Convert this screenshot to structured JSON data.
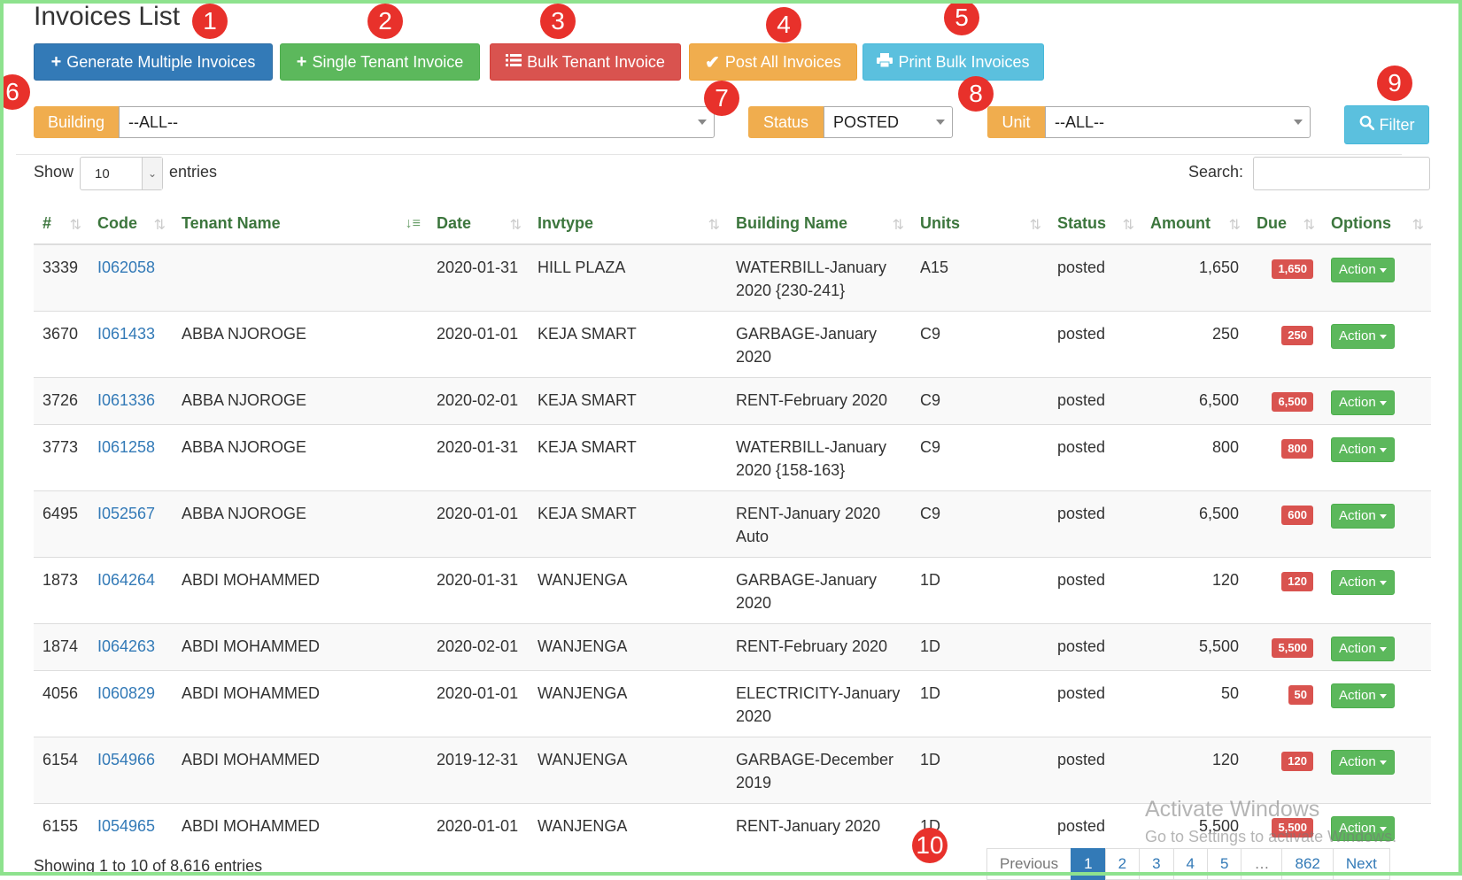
{
  "page": {
    "title": "Invoices List"
  },
  "toolbar": {
    "generate_multiple": "Generate Multiple Invoices",
    "single_tenant": "Single Tenant Invoice",
    "bulk_tenant": "Bulk Tenant Invoice",
    "post_all": "Post All Invoices",
    "print_bulk": "Print Bulk Invoices"
  },
  "filters": {
    "building_label": "Building",
    "building_value": "--ALL--",
    "status_label": "Status",
    "status_value": "POSTED",
    "unit_label": "Unit",
    "unit_value": "--ALL--",
    "filter_button": "Filter"
  },
  "table_controls": {
    "show_label": "Show",
    "entries_value": "10",
    "entries_label": "entries",
    "search_label": "Search:"
  },
  "table": {
    "headers": [
      "#",
      "Code",
      "Tenant Name",
      "Date",
      "Invtype",
      "Building Name",
      "Units",
      "Status",
      "Amount",
      "Due",
      "Options"
    ],
    "rows": [
      {
        "id": "3339",
        "code": "I062058",
        "tenant": "",
        "date": "2020-01-31",
        "invtype": "HILL PLAZA",
        "building": "WATERBILL-January 2020 {230-241}",
        "units": "A15",
        "status": "posted",
        "amount": "1,650",
        "due": "1,650",
        "action": "Action"
      },
      {
        "id": "3670",
        "code": "I061433",
        "tenant": "ABBA NJOROGE",
        "date": "2020-01-01",
        "invtype": "KEJA SMART",
        "building": "GARBAGE-January 2020",
        "units": "C9",
        "status": "posted",
        "amount": "250",
        "due": "250",
        "action": "Action"
      },
      {
        "id": "3726",
        "code": "I061336",
        "tenant": "ABBA NJOROGE",
        "date": "2020-02-01",
        "invtype": "KEJA SMART",
        "building": "RENT-February 2020",
        "units": "C9",
        "status": "posted",
        "amount": "6,500",
        "due": "6,500",
        "action": "Action"
      },
      {
        "id": "3773",
        "code": "I061258",
        "tenant": "ABBA NJOROGE",
        "date": "2020-01-31",
        "invtype": "KEJA SMART",
        "building": "WATERBILL-January 2020 {158-163}",
        "units": "C9",
        "status": "posted",
        "amount": "800",
        "due": "800",
        "action": "Action"
      },
      {
        "id": "6495",
        "code": "I052567",
        "tenant": "ABBA NJOROGE",
        "date": "2020-01-01",
        "invtype": "KEJA SMART",
        "building": "RENT-January 2020 Auto",
        "units": "C9",
        "status": "posted",
        "amount": "6,500",
        "due": "600",
        "action": "Action"
      },
      {
        "id": "1873",
        "code": "I064264",
        "tenant": "ABDI MOHAMMED",
        "date": "2020-01-31",
        "invtype": "WANJENGA",
        "building": "GARBAGE-January 2020",
        "units": "1D",
        "status": "posted",
        "amount": "120",
        "due": "120",
        "action": "Action"
      },
      {
        "id": "1874",
        "code": "I064263",
        "tenant": "ABDI MOHAMMED",
        "date": "2020-02-01",
        "invtype": "WANJENGA",
        "building": "RENT-February 2020",
        "units": "1D",
        "status": "posted",
        "amount": "5,500",
        "due": "5,500",
        "action": "Action"
      },
      {
        "id": "4056",
        "code": "I060829",
        "tenant": "ABDI MOHAMMED",
        "date": "2020-01-01",
        "invtype": "WANJENGA",
        "building": "ELECTRICITY-January 2020",
        "units": "1D",
        "status": "posted",
        "amount": "50",
        "due": "50",
        "action": "Action"
      },
      {
        "id": "6154",
        "code": "I054966",
        "tenant": "ABDI MOHAMMED",
        "date": "2019-12-31",
        "invtype": "WANJENGA",
        "building": "GARBAGE-December 2019",
        "units": "1D",
        "status": "posted",
        "amount": "120",
        "due": "120",
        "action": "Action"
      },
      {
        "id": "6155",
        "code": "I054965",
        "tenant": "ABDI MOHAMMED",
        "date": "2020-01-01",
        "invtype": "WANJENGA",
        "building": "RENT-January 2020",
        "units": "1D",
        "status": "posted",
        "amount": "5,500",
        "due": "5,500",
        "action": "Action"
      }
    ]
  },
  "footer": {
    "info": "Showing 1 to 10 of 8,616 entries",
    "pages": [
      "Previous",
      "1",
      "2",
      "3",
      "4",
      "5",
      "…",
      "862",
      "Next"
    ]
  },
  "annotations": [
    "1",
    "2",
    "3",
    "4",
    "5",
    "6",
    "7",
    "8",
    "9",
    "10"
  ],
  "watermark": {
    "line1": "Activate Windows",
    "line2": "Go to Settings to activate Windows."
  },
  "colors": {
    "primary": "#337ab7",
    "success": "#5cb85c",
    "danger": "#d9534f",
    "warning": "#f0ad4e",
    "info": "#5bc0de",
    "header_text": "#3c763d",
    "annotation": "#e8312b",
    "frame": "#8ee28e"
  }
}
